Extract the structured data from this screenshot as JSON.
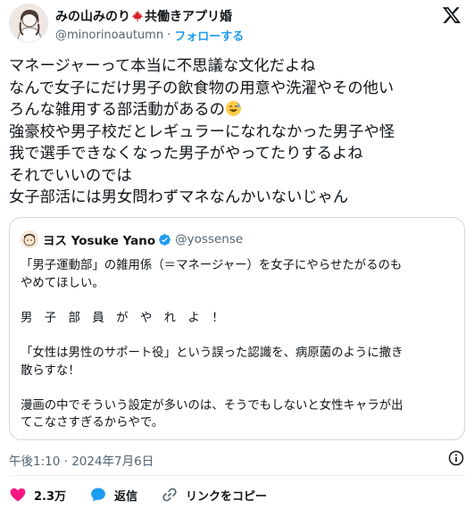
{
  "author": {
    "display_name": "みの山みのり",
    "display_name_suffix": "共働きアプリ婚",
    "handle": "@minorinoautumn",
    "separator": "·",
    "follow_label": "フォローする"
  },
  "tweet": {
    "line1": "マネージャーって本当に不思議な文化だよね",
    "line2": "なんで女子にだけ男子の飲食物の用意や洗濯やその他い",
    "line3": "ろんな雑用する部活動があるの",
    "line4": "強豪校や男子校だとレギュラーになれなかった男子や怪",
    "line5": "我で選手できなくなった男子がやってたりするよね",
    "line6": "それでいいのでは",
    "line7": "女子部活には男女問わずマネなんかいないじゃん",
    "emoji": "sweat-smile-emoji"
  },
  "quote": {
    "display_name": "ヨス Yosuke Yano",
    "handle": "@yossense",
    "p1": "「男子運動部」の雑用係（＝マネージャー）を女子にやらせたがるのも\nやめてほしい。",
    "p2": "男　子　部　員　が　や　れ　よ　！",
    "p3": "「女性は男性のサポート役」という誤った認識を、病原菌のように撒き\n散らすな！",
    "p4": "漫画の中でそういう設定が多いのは、そうでもしないと女性キャラが出\nてこなさすぎるからやで。"
  },
  "timestamp": "午後1:10 · 2024年7月6日",
  "actions": {
    "likes": "2.3万",
    "reply": "返信",
    "copy_link": "リンクをコピー"
  },
  "colors": {
    "accent": "#1d9bf0",
    "like": "#f91880",
    "text": "#0f1419",
    "muted": "#536471"
  }
}
